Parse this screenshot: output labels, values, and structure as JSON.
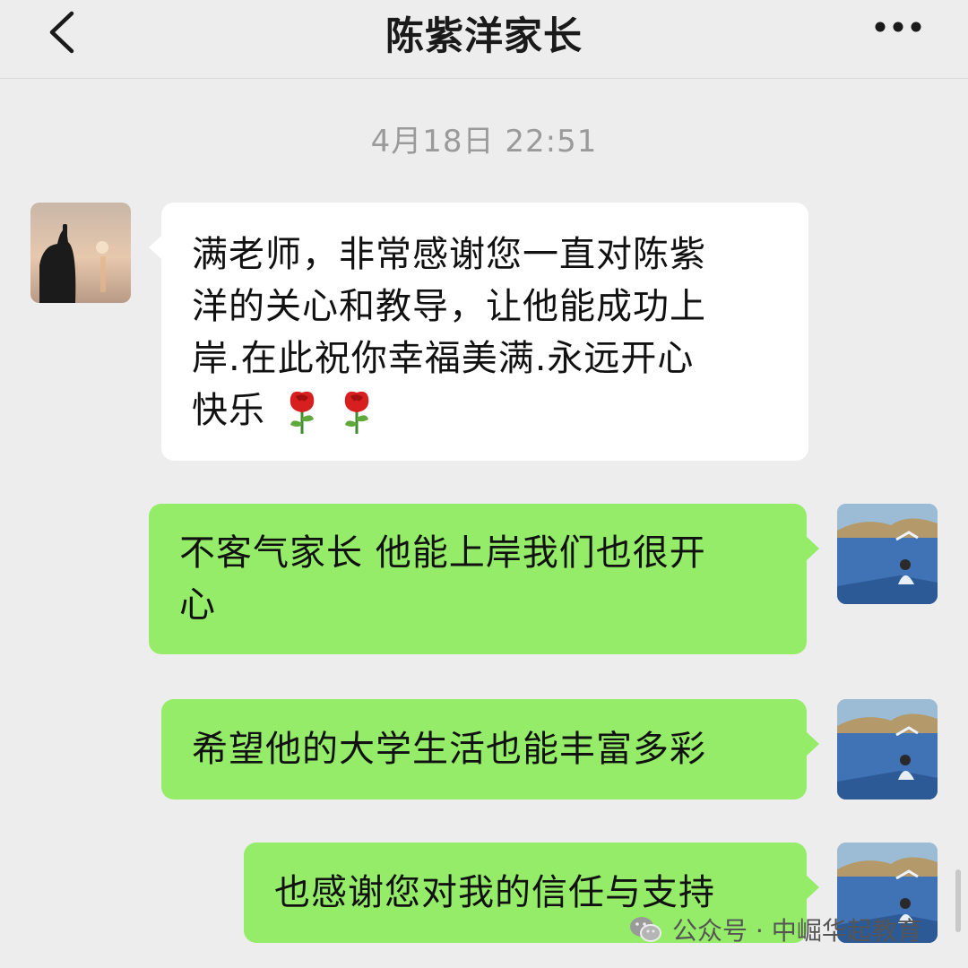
{
  "header": {
    "title": "陈紫洋家长",
    "back_icon": "chevron-left-icon",
    "more_icon": "more-dots-icon"
  },
  "timestamp": "4月18日 22:51",
  "messages": [
    {
      "side": "left",
      "sender": "parent",
      "lines": [
        "满老师，非常感谢您一直对陈紫",
        "洋的关心和教导，让他能成功上",
        "岸.在此祝你幸福美满.永远开心",
        "快乐"
      ],
      "emoji": [
        "rose",
        "rose"
      ]
    },
    {
      "side": "right",
      "sender": "teacher",
      "lines": [
        "不客气家长 他能上岸我们也很开",
        "心"
      ]
    },
    {
      "side": "right",
      "sender": "teacher",
      "lines": [
        "希望他的大学生活也能丰富多彩"
      ]
    },
    {
      "side": "right",
      "sender": "teacher",
      "lines": [
        "也感谢您对我的信任与支持"
      ]
    }
  ],
  "watermark": {
    "text": "公众号 · 中崛华起教育",
    "icon": "wechat-icon"
  },
  "colors": {
    "background": "#ededed",
    "incoming_bubble": "#ffffff",
    "outgoing_bubble": "#95ec69",
    "timestamp_text": "#9a9a9a"
  }
}
